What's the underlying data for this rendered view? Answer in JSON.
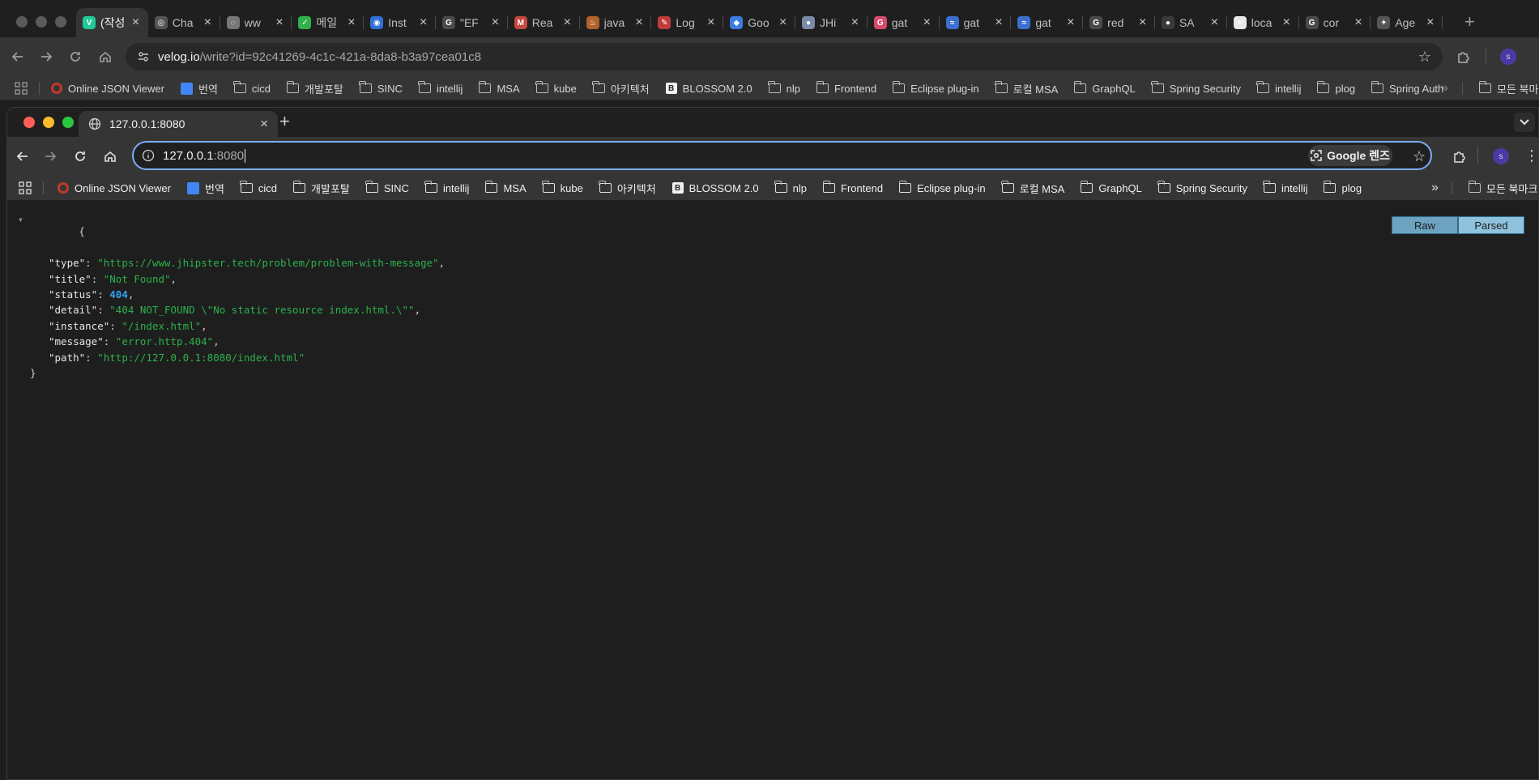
{
  "outer": {
    "tabs": [
      {
        "title": "(작성",
        "icon": "velog-icon",
        "color": "#20c997",
        "glyph": "V",
        "active": true
      },
      {
        "title": "Cha",
        "icon": "chatgpt-icon",
        "color": "#555555",
        "glyph": "◎"
      },
      {
        "title": "ww",
        "icon": "globe-icon",
        "color": "#777777",
        "glyph": "◌"
      },
      {
        "title": "메일",
        "icon": "mail-shield-icon",
        "color": "#2fb14c",
        "glyph": "✓"
      },
      {
        "title": "Inst",
        "icon": "eye-icon",
        "color": "#2f6fd6",
        "glyph": "◉"
      },
      {
        "title": "\"EF",
        "icon": "google-icon",
        "color": "#4a4a4a",
        "glyph": "G"
      },
      {
        "title": "Rea",
        "icon": "gmail-icon",
        "color": "#c4483e",
        "glyph": "M"
      },
      {
        "title": "java",
        "icon": "java-icon",
        "color": "#b0622a",
        "glyph": "♨"
      },
      {
        "title": "Log",
        "icon": "pen-icon",
        "color": "#c23b3b",
        "glyph": "✎"
      },
      {
        "title": "Goo",
        "icon": "google-cloud-icon",
        "color": "#3b7be0",
        "glyph": "◆"
      },
      {
        "title": "JHi",
        "icon": "jhipster-icon",
        "color": "#7a8aa8",
        "glyph": "●"
      },
      {
        "title": "gat",
        "icon": "g-red-icon",
        "color": "#d84a6a",
        "glyph": "G"
      },
      {
        "title": "gat",
        "icon": "mask-icon",
        "color": "#3b6fd0",
        "glyph": "≈"
      },
      {
        "title": "gat",
        "icon": "mask-icon",
        "color": "#3b6fd0",
        "glyph": "≈"
      },
      {
        "title": "red",
        "icon": "google-icon",
        "color": "#4a4a4a",
        "glyph": "G"
      },
      {
        "title": "SA",
        "icon": "github-icon",
        "color": "#3a3a3a",
        "glyph": "●"
      },
      {
        "title": "loca",
        "icon": "mask-icon",
        "color": "#e8e8e8",
        "glyph": "≈"
      },
      {
        "title": "cor",
        "icon": "google-icon",
        "color": "#4a4a4a",
        "glyph": "G"
      },
      {
        "title": "Age",
        "icon": "helm-icon",
        "color": "#555555",
        "glyph": "✦"
      }
    ],
    "new_tab": "+",
    "url_host": "velog.io",
    "url_rest": "/write?id=92c41269-4c1c-421a-8da8-b3a97cea01c8",
    "profile_initial": "s",
    "bookmarks": [
      "Online JSON Viewer",
      "번역",
      "cicd",
      "개발포탈",
      "SINC",
      "intellij",
      "MSA",
      "kube",
      "아키텍처",
      "BLOSSOM 2.0",
      "nlp",
      "Frontend",
      "Eclipse plug-in",
      "로컬 MSA",
      "GraphQL",
      "Spring Security",
      "intellij",
      "plog",
      "Spring Auth"
    ],
    "bookmarks_more": "»",
    "all_bookmarks": "모든 북마크"
  },
  "inner": {
    "tab_title": "127.0.0.1:8080",
    "new_tab": "+",
    "url_host": "127.0.0.1",
    "url_port": ":8080",
    "lens_label": "Google 렌즈",
    "profile_initial": "s",
    "bookmarks": [
      "Online JSON Viewer",
      "번역",
      "cicd",
      "개발포탈",
      "SINC",
      "intellij",
      "MSA",
      "kube",
      "아키텍처",
      "BLOSSOM 2.0",
      "nlp",
      "Frontend",
      "Eclipse plug-in",
      "로컬 MSA",
      "GraphQL",
      "Spring Security",
      "intellij",
      "plog"
    ],
    "bookmarks_more": "»",
    "all_bookmarks": "모든 북마크"
  },
  "viewer": {
    "raw_label": "Raw",
    "parsed_label": "Parsed",
    "collapse_glyph": "▼",
    "open_brace": "{",
    "close_brace": "}",
    "entries": [
      {
        "key": "\"type\"",
        "value": "\"https://www.jhipster.tech/problem/problem-with-message\"",
        "kind": "s",
        "comma": ","
      },
      {
        "key": "\"title\"",
        "value": "\"Not Found\"",
        "kind": "s",
        "comma": ","
      },
      {
        "key": "\"status\"",
        "value": "404",
        "kind": "n",
        "comma": ","
      },
      {
        "key": "\"detail\"",
        "value": "\"404 NOT_FOUND \\\"No static resource index.html.\\\"\"",
        "kind": "s",
        "comma": ","
      },
      {
        "key": "\"instance\"",
        "value": "\"/index.html\"",
        "kind": "s",
        "comma": ","
      },
      {
        "key": "\"message\"",
        "value": "\"error.http.404\"",
        "kind": "s",
        "comma": ","
      },
      {
        "key": "\"path\"",
        "value": "\"http://127.0.0.1:8080/index.html\"",
        "kind": "s",
        "comma": ""
      }
    ]
  }
}
